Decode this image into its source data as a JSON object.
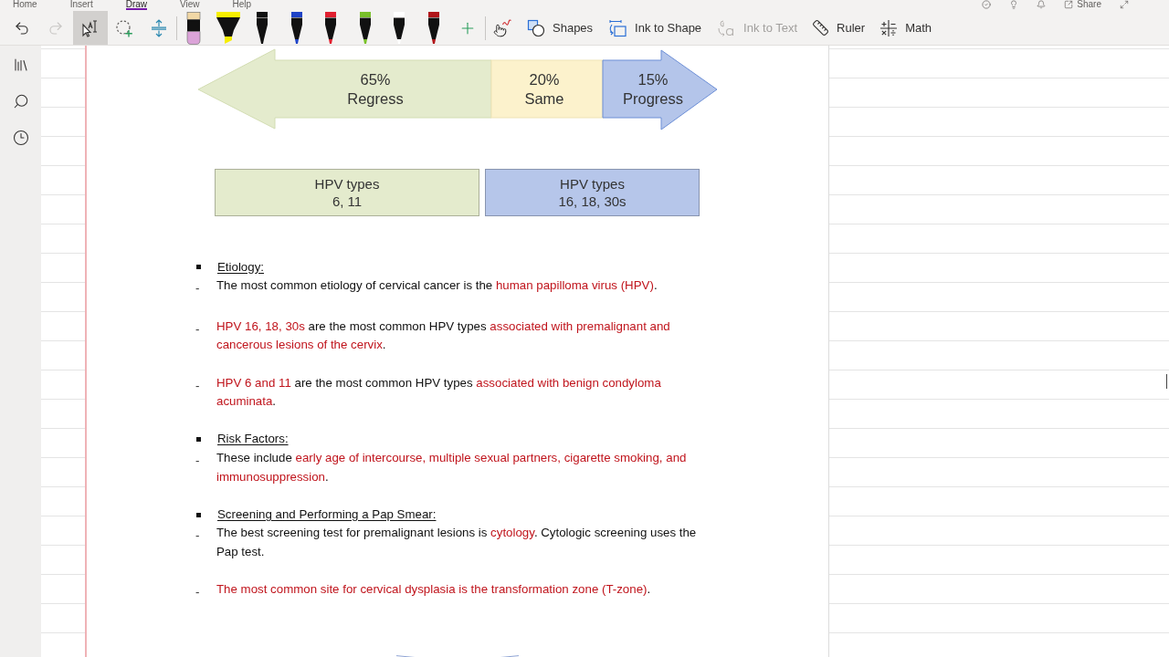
{
  "ribbon_tabs": [
    {
      "label": "Home",
      "selected": false
    },
    {
      "label": "Insert",
      "selected": false
    },
    {
      "label": "Draw",
      "selected": true
    },
    {
      "label": "View",
      "selected": false
    },
    {
      "label": "Help",
      "selected": false
    }
  ],
  "title_bar": {
    "share_label": "Share"
  },
  "toolbar": {
    "tools": [
      {
        "kind": "undo",
        "disabled": false
      },
      {
        "kind": "redo",
        "disabled": true
      },
      {
        "kind": "type_select",
        "selected": true
      },
      {
        "kind": "lasso",
        "selected": false
      },
      {
        "kind": "add_space",
        "selected": false
      }
    ],
    "pens": [
      {
        "kind": "eraser",
        "selected": false
      },
      {
        "kind": "highlighter",
        "color": "#f6ee00",
        "selected": false
      },
      {
        "kind": "pen",
        "color": "#111111",
        "selected": false
      },
      {
        "kind": "pen",
        "color": "#1f43c6",
        "selected": false
      },
      {
        "kind": "pen",
        "color": "#e02030",
        "selected": false
      },
      {
        "kind": "pen",
        "color": "#78c02a",
        "selected": false
      },
      {
        "kind": "pen",
        "color": "#ffffff",
        "selected": false
      },
      {
        "kind": "pen",
        "color": "#b0161a",
        "selected": false
      }
    ],
    "actions": [
      {
        "kind": "shapes",
        "label": "Shapes",
        "disabled": false
      },
      {
        "kind": "ink_to_shape",
        "label": "Ink to Shape",
        "disabled": false
      },
      {
        "kind": "ink_to_text",
        "label": "Ink to Text",
        "disabled": true
      },
      {
        "kind": "ruler",
        "label": "Ruler",
        "disabled": false
      },
      {
        "kind": "math",
        "label": "Math",
        "disabled": false
      }
    ]
  },
  "diagram": {
    "outcomes": [
      {
        "kind": "left_arrow",
        "percent": "65%",
        "label": "Regress",
        "color": "#e4ebcd"
      },
      {
        "kind": "bar",
        "percent": "20%",
        "label": "Same",
        "color": "#fcf2cc"
      },
      {
        "kind": "right_arrow",
        "percent": "15%",
        "label": "Progress",
        "color": "#b4c5ea"
      }
    ],
    "hpv_groups": [
      {
        "title": "HPV types",
        "types": "6, 11",
        "color": "#e4ebcd"
      },
      {
        "title": "HPV types",
        "types": "16, 18, 30s",
        "color": "#b6c6ea"
      }
    ]
  },
  "notes": [
    {
      "kind": "heading",
      "text": "Etiology:"
    },
    {
      "kind": "item",
      "marker": "-",
      "segments": [
        {
          "text": "The most common etiology of cervical cancer is the ",
          "emphasis": false
        },
        {
          "text": "human papilloma virus (HPV)",
          "emphasis": true
        },
        {
          "text": ".",
          "emphasis": false
        }
      ]
    },
    {
      "kind": "item",
      "marker": "-",
      "segments": [
        {
          "text": "HPV 16, 18, 30s",
          "emphasis": true
        },
        {
          "text": " are the most common HPV types ",
          "emphasis": false
        },
        {
          "text": "associated with premalignant and cancerous lesions of the cervix",
          "emphasis": true
        },
        {
          "text": ".",
          "emphasis": false
        }
      ]
    },
    {
      "kind": "item",
      "marker": "-",
      "segments": [
        {
          "text": "HPV 6 and 11",
          "emphasis": true
        },
        {
          "text": " are the most common HPV types ",
          "emphasis": false
        },
        {
          "text": "associated with benign condyloma acuminata",
          "emphasis": true
        },
        {
          "text": ".",
          "emphasis": false
        }
      ]
    },
    {
      "kind": "heading",
      "text": "Risk Factors:"
    },
    {
      "kind": "item",
      "marker": "-",
      "segments": [
        {
          "text": "These include ",
          "emphasis": false
        },
        {
          "text": "early age of intercourse, multiple sexual partners, cigarette smoking, and immunosuppression",
          "emphasis": true
        },
        {
          "text": ".",
          "emphasis": false
        }
      ]
    },
    {
      "kind": "heading",
      "text": "Screening and Performing a Pap Smear:"
    },
    {
      "kind": "item",
      "marker": "-",
      "segments": [
        {
          "text": "The best screening test for premalignant lesions is ",
          "emphasis": false
        },
        {
          "text": "cytology",
          "emphasis": true
        },
        {
          "text": ". Cytologic screening uses the Pap test.",
          "emphasis": false
        }
      ]
    },
    {
      "kind": "item",
      "marker": "-",
      "segments": [
        {
          "text": "The most common site for cervical dysplasia is the transformation zone (T-zone)",
          "emphasis": true
        },
        {
          "text": ".",
          "emphasis": false
        }
      ]
    }
  ]
}
